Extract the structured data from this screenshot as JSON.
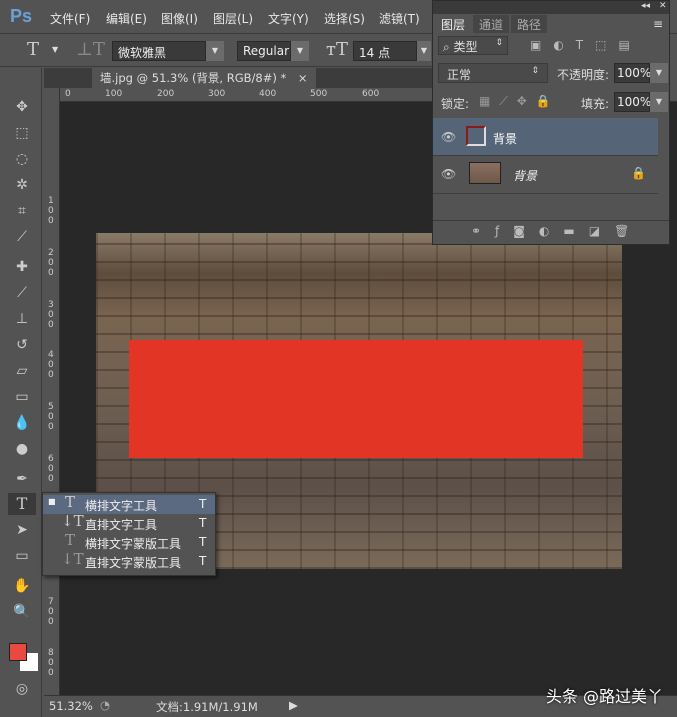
{
  "app": {
    "logo": "Ps"
  },
  "menu": [
    "文件(F)",
    "编辑(E)",
    "图像(I)",
    "图层(L)",
    "文字(Y)",
    "选择(S)",
    "滤镜(T)"
  ],
  "options": {
    "font_family": "微软雅黑",
    "font_style": "Regular",
    "font_size": "14 点"
  },
  "document": {
    "tab_title": "墙.jpg @ 51.3% (背景, RGB/8#) *",
    "close": "×"
  },
  "rulers": {
    "h": [
      "0",
      "100",
      "200",
      "300",
      "400",
      "500",
      "600"
    ],
    "v": [
      "1\n0\n0",
      "2\n0\n0",
      "3\n0\n0",
      "4\n0\n0",
      "5\n0\n0",
      "6\n0\n0",
      "7\n0\n0",
      "8\n0\n0"
    ]
  },
  "flyout": [
    {
      "label": "横排文字工具",
      "key": "T",
      "selected": true
    },
    {
      "label": "直排文字工具",
      "key": "T"
    },
    {
      "label": "横排文字蒙版工具",
      "key": "T"
    },
    {
      "label": "直排文字蒙版工具",
      "key": "T"
    }
  ],
  "status": {
    "zoom": "51.32%",
    "doc": "文档:1.91M/1.91M"
  },
  "layers_panel": {
    "tabs": [
      "图层",
      "通道",
      "路径"
    ],
    "filter": "类型",
    "blend": "正常",
    "opacity_label": "不透明度:",
    "opacity": "100%",
    "lock_label": "锁定:",
    "fill_label": "填充:",
    "fill": "100%",
    "layers": [
      {
        "name": "背景",
        "type": "shape",
        "selected": true
      },
      {
        "name": "背景",
        "type": "image",
        "locked": true
      }
    ]
  },
  "colors": {
    "foreground": "#e84a3f",
    "background": "#ffffff",
    "shape": "#e23526"
  },
  "watermark": "头条 @路过美丫"
}
